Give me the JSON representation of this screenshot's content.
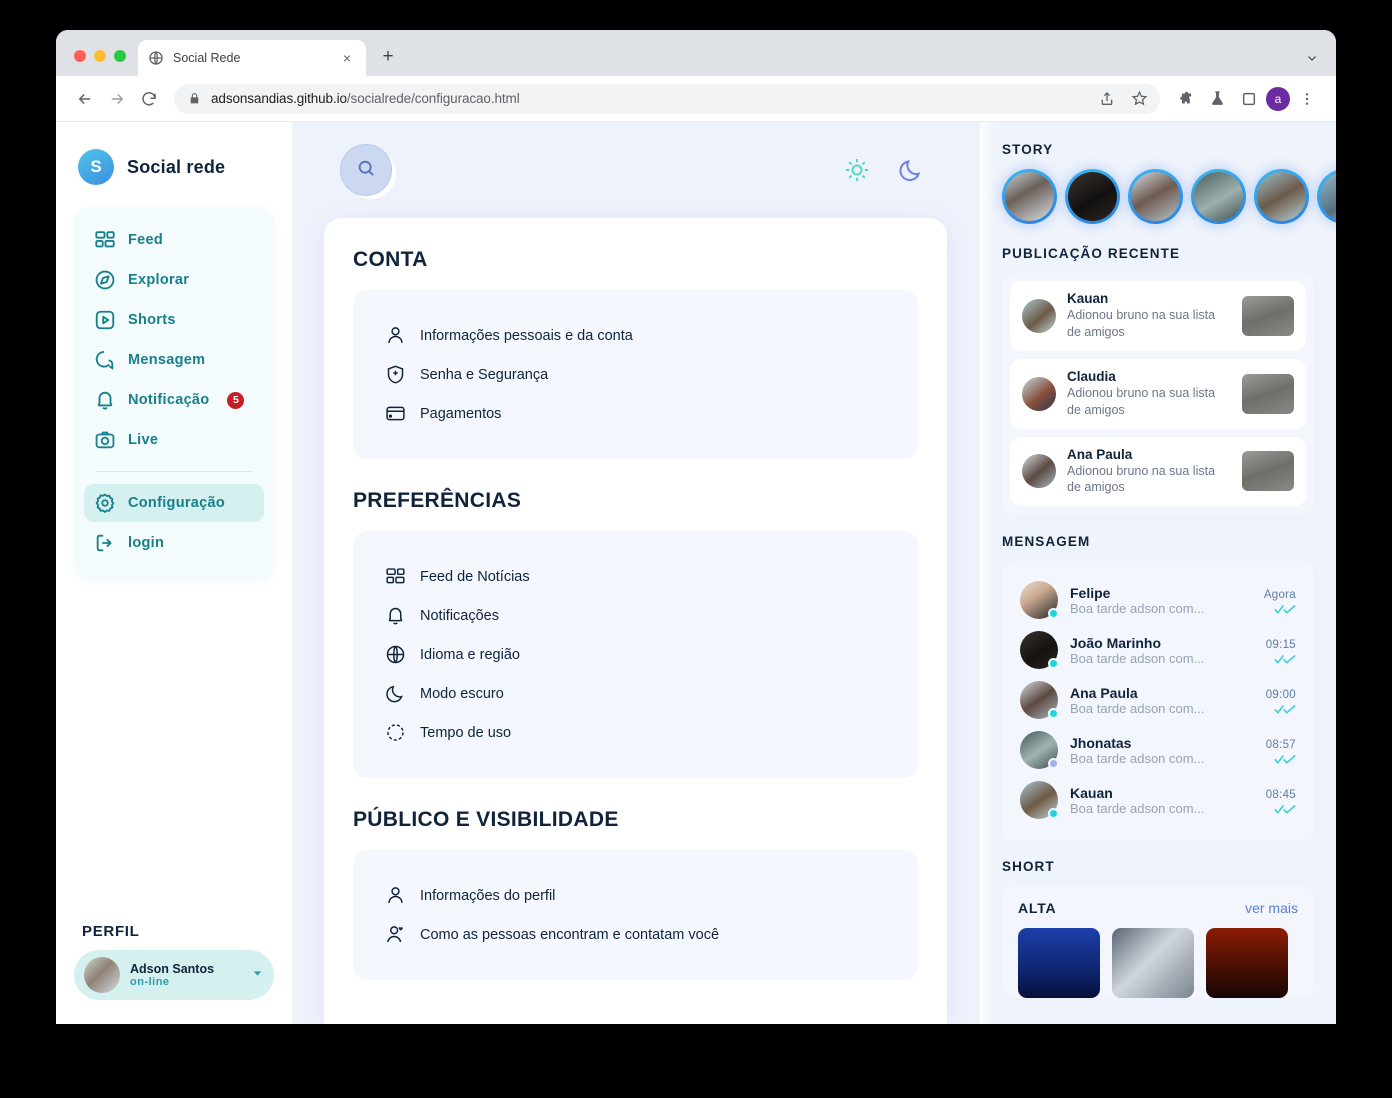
{
  "browser": {
    "tab": {
      "title": "Social Rede",
      "favicon": "globe-icon",
      "close": "×"
    },
    "new_tab": "+",
    "url_secure": "adsonsandias.github.io",
    "url_path": "/socialrede/configuracao.html",
    "profile_initial": "a",
    "nav": {
      "back": "←",
      "forward": "→",
      "reload": "↻"
    },
    "actions": [
      "share-icon",
      "bookmark-star-icon",
      "extensions-puzzle-icon",
      "lab-flask-icon",
      "side-panel-icon",
      "profile-avatar",
      "more-menu-icon"
    ]
  },
  "sidebar": {
    "brand": {
      "initial": "S",
      "name": "Social rede"
    },
    "items": [
      {
        "label": "Feed",
        "icon": "feed-grid-icon",
        "active": false
      },
      {
        "label": "Explorar",
        "icon": "compass-icon",
        "active": false
      },
      {
        "label": "Shorts",
        "icon": "play-box-icon",
        "active": false
      },
      {
        "label": "Mensagem",
        "icon": "chat-bubble-icon",
        "active": false
      },
      {
        "label": "Notificação",
        "icon": "bell-icon",
        "active": false,
        "badge": "5"
      },
      {
        "label": "Live",
        "icon": "camera-icon",
        "active": false
      }
    ],
    "items_secondary": [
      {
        "label": "Configuração",
        "icon": "gear-icon",
        "active": true
      },
      {
        "label": "login",
        "icon": "logout-icon",
        "active": false
      }
    ],
    "profile": {
      "title": "PERFIL",
      "name": "Adson Santos",
      "status": "on-line",
      "caret": "▼"
    }
  },
  "main": {
    "search_icon": "search-icon",
    "theme": {
      "light_icon": "sun-icon",
      "dark_icon": "moon-icon"
    },
    "sections": [
      {
        "title": "CONTA",
        "options": [
          {
            "label": "Informações pessoais e da conta",
            "icon": "user-icon"
          },
          {
            "label": "Senha e Segurança",
            "icon": "shield-plus-icon"
          },
          {
            "label": "Pagamentos",
            "icon": "credit-card-icon"
          }
        ]
      },
      {
        "title": "PREFERÊNCIAS",
        "options": [
          {
            "label": "Feed de Notícias",
            "icon": "feed-grid-icon"
          },
          {
            "label": "Notificações",
            "icon": "bell-icon"
          },
          {
            "label": "Idioma e região",
            "icon": "globe-icon"
          },
          {
            "label": "Modo escuro",
            "icon": "moon-icon"
          },
          {
            "label": "Tempo de uso",
            "icon": "timer-icon"
          }
        ]
      },
      {
        "title": "PÚBLICO E VISIBILIDADE",
        "options": [
          {
            "label": "Informações do perfil",
            "icon": "user-icon"
          },
          {
            "label": "Como as pessoas encontram e contatam você",
            "icon": "user-heart-icon"
          }
        ]
      }
    ]
  },
  "right_panel": {
    "story_heading": "STORY",
    "stories": [
      {
        "name": "story-1"
      },
      {
        "name": "story-2"
      },
      {
        "name": "story-3"
      },
      {
        "name": "story-4"
      },
      {
        "name": "story-5"
      },
      {
        "name": "story-6"
      }
    ],
    "recent_heading": "PUBLICAÇÃO RECENTE",
    "recent": [
      {
        "name": "Kauan",
        "text": "Adionou bruno na sua lista de amigos"
      },
      {
        "name": "Claudia",
        "text": "Adionou bruno na sua lista de amigos"
      },
      {
        "name": "Ana Paula",
        "text": "Adionou bruno na sua lista de amigos"
      }
    ],
    "message_heading": "MENSAGEM",
    "messages": [
      {
        "name": "Felipe",
        "preview": "Boa tarde adson com...",
        "time": "Agora"
      },
      {
        "name": "João Marinho",
        "preview": "Boa tarde adson com...",
        "time": "09:15"
      },
      {
        "name": "Ana Paula",
        "preview": "Boa tarde adson com...",
        "time": "09:00"
      },
      {
        "name": "Jhonatas",
        "preview": "Boa tarde adson com...",
        "time": "08:57"
      },
      {
        "name": "Kauan",
        "preview": "Boa tarde adson com...",
        "time": "08:45"
      }
    ],
    "short_heading": "SHORT",
    "short_label": "ALTA",
    "short_more": "ver mais",
    "short_thumbs": [
      "short-thumb-1",
      "short-thumb-2",
      "short-thumb-3"
    ]
  },
  "colors": {
    "brand_teal": "#17808c",
    "accent_blue": "#3c8fe0",
    "badge_red": "#c42026",
    "active_nav": "#d4f0ef",
    "page_bg": "#eef2fb",
    "card_bg": "#f4f7fd",
    "text_dark": "#10233c",
    "check_cyan": "#3ecfd8"
  }
}
